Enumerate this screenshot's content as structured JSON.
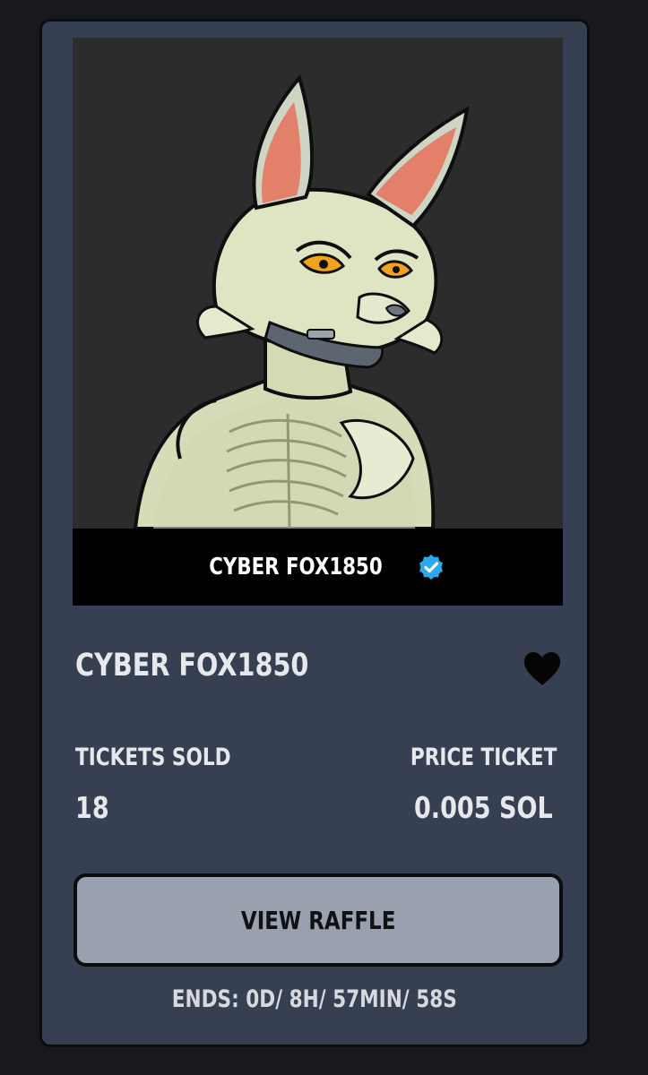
{
  "nft": {
    "nameplate": "CYBER FOX1850",
    "title": "CYBER FOX1850",
    "verified_icon": "verified-badge-icon",
    "favorite_icon": "heart-icon"
  },
  "stats": {
    "tickets_sold_label": "TICKETS SOLD",
    "tickets_sold_value": "18",
    "price_label": "PRICE TICKET",
    "price_value": "0.005 SOL"
  },
  "actions": {
    "view_raffle_label": "VIEW RAFFLE"
  },
  "timer": {
    "ends_text": "ENDS: 0D/ 8H/ 57MIN/ 58S"
  },
  "colors": {
    "card_bg": "#364052",
    "button_bg": "#9aa1ae",
    "verified": "#2aa8f0"
  }
}
